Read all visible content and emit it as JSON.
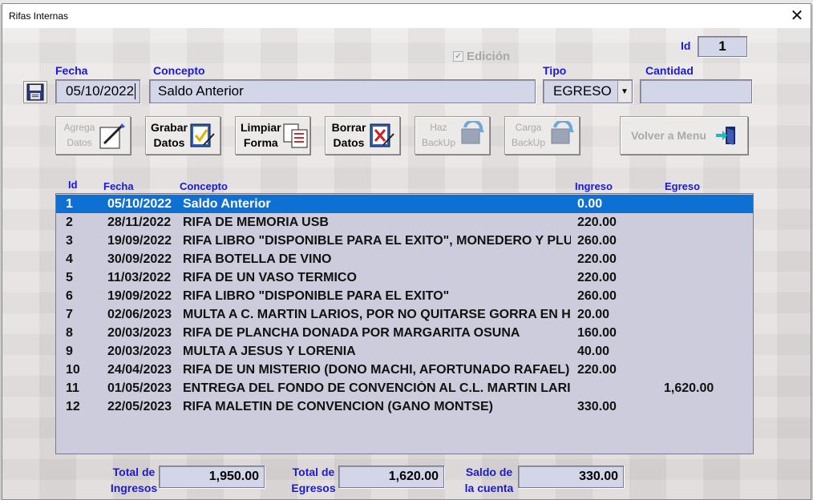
{
  "window": {
    "title": "Rifas Internas",
    "close_label": "✕"
  },
  "form": {
    "edicion_label": "Edición",
    "edicion_checked": true,
    "id_label": "Id",
    "id_value": "1",
    "fecha_label": "Fecha",
    "fecha_value": "05/10/2022",
    "concepto_label": "Concepto",
    "concepto_value": "Saldo Anterior",
    "tipo_label": "Tipo",
    "tipo_value": "EGRESO",
    "cantidad_label": "Cantidad",
    "cantidad_value": ""
  },
  "toolbar": {
    "agrega": {
      "line1": "Agrega",
      "line2": "Datos",
      "icon": "pen-paper-icon",
      "enabled": false
    },
    "grabar": {
      "line1": "Grabar",
      "line2": "Datos",
      "icon": "check-document-icon",
      "enabled": true
    },
    "limpiar": {
      "line1": "Limpiar",
      "line2": "Forma",
      "icon": "copy-documents-icon",
      "enabled": true
    },
    "borrar": {
      "line1": "Borrar",
      "line2": "Datos",
      "icon": "delete-document-icon",
      "enabled": true
    },
    "haz_backup": {
      "line1": "Haz",
      "line2": "BackUp",
      "icon": "backup-icon",
      "enabled": false
    },
    "carga_backup": {
      "line1": "Carga",
      "line2": "BackUp",
      "icon": "restore-backup-icon",
      "enabled": false
    },
    "volver": {
      "label": "Volver a Menu",
      "icon": "exit-door-icon",
      "enabled": false
    }
  },
  "list": {
    "headers": {
      "id": "Id",
      "fecha": "Fecha",
      "concepto": "Concepto",
      "ingreso": "Ingreso",
      "egreso": "Egreso"
    },
    "selected_index": 0,
    "rows": [
      {
        "id": "1",
        "fecha": "05/10/2022",
        "concepto": "Saldo Anterior",
        "ingreso": "0.00",
        "egreso": ""
      },
      {
        "id": "2",
        "fecha": "28/11/2022",
        "concepto": "RIFA DE MEMORIA USB",
        "ingreso": "220.00",
        "egreso": ""
      },
      {
        "id": "3",
        "fecha": "19/09/2022",
        "concepto": "RIFA LIBRO \"DISPONIBLE PARA EL EXITO\", MONEDERO Y PLUMA",
        "ingreso": "260.00",
        "egreso": ""
      },
      {
        "id": "4",
        "fecha": "30/09/2022",
        "concepto": "RIFA BOTELLA DE VINO",
        "ingreso": "220.00",
        "egreso": ""
      },
      {
        "id": "5",
        "fecha": "11/03/2022",
        "concepto": "RIFA DE UN VASO TERMICO",
        "ingreso": "220.00",
        "egreso": ""
      },
      {
        "id": "6",
        "fecha": "19/09/2022",
        "concepto": "RIFA LIBRO \"DISPONIBLE PARA EL EXITO\"",
        "ingreso": "260.00",
        "egreso": ""
      },
      {
        "id": "7",
        "fecha": "02/06/2023",
        "concepto": "MULTA A C. MARTIN LARIOS, POR NO QUITARSE GORRA EN HONORES",
        "ingreso": "20.00",
        "egreso": ""
      },
      {
        "id": "8",
        "fecha": "20/03/2023",
        "concepto": "RIFA DE PLANCHA  DONADA POR MARGARITA OSUNA",
        "ingreso": "160.00",
        "egreso": ""
      },
      {
        "id": "9",
        "fecha": "20/03/2023",
        "concepto": "MULTA A JESUS Y LORENIA",
        "ingreso": "40.00",
        "egreso": ""
      },
      {
        "id": "10",
        "fecha": "24/04/2023",
        "concepto": "RIFA DE UN MISTERIO (DONO MACHI, AFORTUNADO RAFAEL)",
        "ingreso": "220.00",
        "egreso": ""
      },
      {
        "id": "11",
        "fecha": "01/05/2023",
        "concepto": "ENTREGA DEL FONDO DE CONVENCIÓN AL C.L. MARTIN LARIOS",
        "ingreso": "",
        "egreso": "1,620.00"
      },
      {
        "id": "12",
        "fecha": "22/05/2023",
        "concepto": "RIFA MALETIN DE CONVENCION  (GANO MONTSE)",
        "ingreso": "330.00",
        "egreso": ""
      }
    ]
  },
  "totals": {
    "ingresos_line1": "Total de",
    "ingresos_line2": "Ingresos",
    "ingresos_value": "1,950.00",
    "egresos_line1": "Total de",
    "egresos_line2": "Egresos",
    "egresos_value": "1,620.00",
    "saldo_line1": "Saldo de",
    "saldo_line2": "la cuenta",
    "saldo_value": "330.00"
  },
  "colors": {
    "label_blue": "#1a1ad0",
    "selection": "#0d70d2",
    "field_bg": "#d3d5e8",
    "list_bg": "#ccccdc"
  }
}
